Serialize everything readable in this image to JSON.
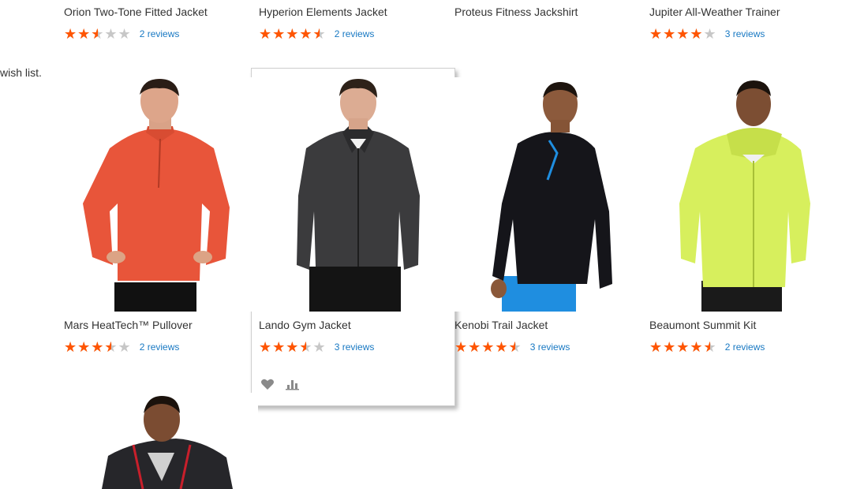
{
  "wishlist_message": "wish list.",
  "products": [
    {
      "name": "Orion Two-Tone Fitted Jacket",
      "rating_stars": 2.5,
      "reviews": "2 reviews"
    },
    {
      "name": "Hyperion Elements Jacket",
      "rating_stars": 4.5,
      "reviews": "2 reviews"
    },
    {
      "name": "Proteus Fitness Jackshirt",
      "rating_stars": null,
      "reviews": ""
    },
    {
      "name": "Jupiter All-Weather Trainer",
      "rating_stars": 4,
      "reviews": "3 reviews"
    },
    {
      "name": "Mars HeatTech™ Pullover",
      "rating_stars": 3.5,
      "reviews": "2 reviews",
      "image": "orange-quarter-zip-pullover"
    },
    {
      "name": "Lando Gym Jacket",
      "rating_stars": 3.5,
      "reviews": "3 reviews",
      "image": "gray-fleece-jacket",
      "hovered": true
    },
    {
      "name": "Kenobi Trail Jacket",
      "rating_stars": 4.5,
      "reviews": "3 reviews",
      "image": "black-quarter-zip-blue-shorts"
    },
    {
      "name": "Beaumont Summit Kit",
      "rating_stars": 4.5,
      "reviews": "2 reviews",
      "image": "lime-green-windbreaker"
    },
    {
      "name": "",
      "image": "black-puffer-jacket-red-zip"
    }
  ],
  "actions": {
    "wishlist_icon": "heart-icon",
    "compare_icon": "bar-chart-icon"
  },
  "colors": {
    "star": "#ff5501",
    "star_empty": "#c7c7c7",
    "link": "#1979c3",
    "text": "#333333"
  }
}
